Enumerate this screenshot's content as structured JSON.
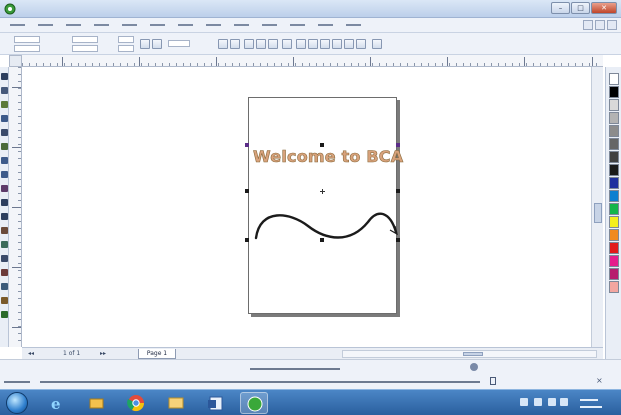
{
  "window": {
    "title": ""
  },
  "menubar": {
    "items": [
      {
        "label": ""
      },
      {
        "label": ""
      },
      {
        "label": ""
      },
      {
        "label": ""
      },
      {
        "label": ""
      },
      {
        "label": ""
      },
      {
        "label": ""
      },
      {
        "label": ""
      },
      {
        "label": ""
      },
      {
        "label": ""
      },
      {
        "label": ""
      },
      {
        "label": ""
      },
      {
        "label": ""
      }
    ]
  },
  "canvas": {
    "text": "Welcome to BCA",
    "text_color": "#d8a27c",
    "curve_color": "#1b1b1b"
  },
  "pagebar": {
    "page_count": "1 of 1",
    "page_tab": "Page 1",
    "nav_first": "◂◂",
    "nav_next": "▸▸"
  },
  "statusbar": {
    "selection_text": "",
    "hint_text": ""
  },
  "palette": {
    "colors": [
      "#ffffff",
      "#000000",
      "#d9d9d9",
      "#b3b3b3",
      "#8c8c8c",
      "#666666",
      "#404040",
      "#1a1a1a",
      "#1e2f9e",
      "#0b7fd0",
      "#13b54a",
      "#f4ee1b",
      "#f08a1f",
      "#e21b1b",
      "#e61e8c",
      "#b71c6e",
      "#f3a6a0"
    ]
  },
  "taskbar": {
    "apps": [
      "start-orb",
      "ie-icon",
      "folder-icon",
      "chrome-icon",
      "explorer-icon",
      "word-icon",
      "coreldraw-icon"
    ],
    "clock_time": "",
    "clock_date": ""
  }
}
